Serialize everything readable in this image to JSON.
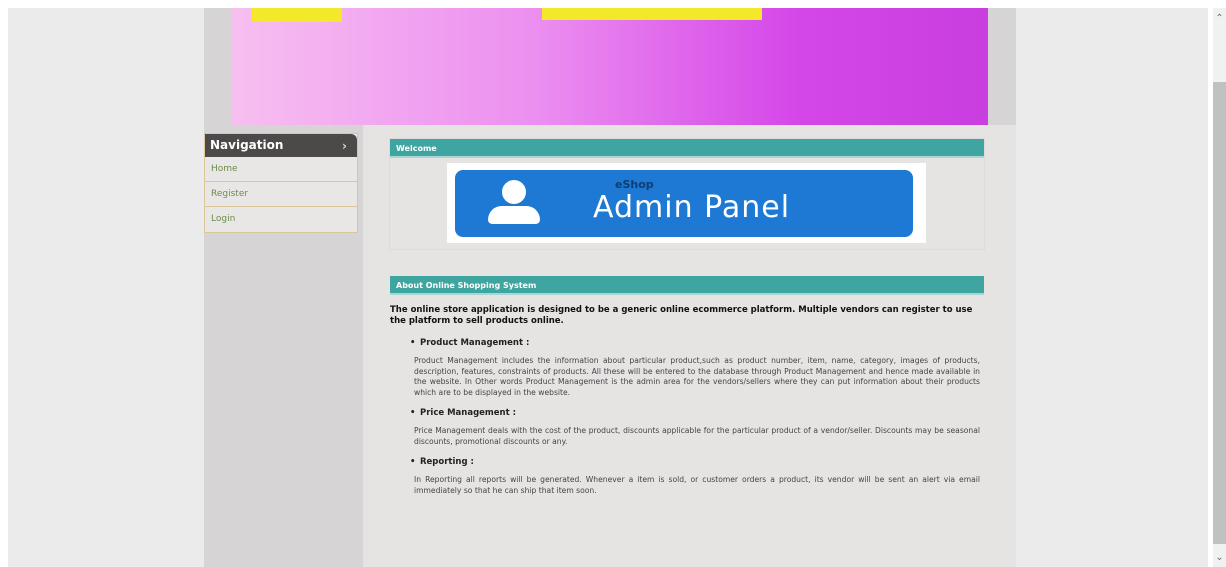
{
  "sidebar": {
    "title": "Navigation",
    "chevron": "›",
    "items": [
      {
        "label": "Home"
      },
      {
        "label": "Register"
      },
      {
        "label": "Login"
      }
    ]
  },
  "welcome": {
    "header": "Welcome",
    "banner_small": "eShop",
    "banner_title": "Admin Panel"
  },
  "about": {
    "header": "About Online Shopping System",
    "intro": "The online store application is designed to be a generic online ecommerce platform. Multiple vendors can register to use the platform to sell products online.",
    "features": [
      {
        "title": "Product Management :",
        "desc": "Product Management includes the information about particular product,such as product number, item, name, category, images of products, description, features, constraints of products. All these will be entered to the database through Product Management and hence made available in the website. In Other words Product Management is the admin area for the vendors/sellers where they can put information about their products which are to be displayed in the website."
      },
      {
        "title": "Price Management :",
        "desc": "Price Management deals with the cost of the product, discounts applicable for the particular product of a vendor/seller. Discounts may be seasonal discounts, promotional discounts or any."
      },
      {
        "title": "Reporting :",
        "desc": "In Reporting all reports will be generated. Whenever a item is sold, or customer orders a product, its vendor will be sent an alert via email immediately so that he can ship that item soon."
      }
    ]
  },
  "scrollbar": {
    "up": "⌃",
    "down": "⌄"
  },
  "colors": {
    "section_header": "#3fa5a1",
    "nav_header": "#4b4a48",
    "admin_panel": "#1d79d4",
    "nav_link": "#6b8c4b"
  }
}
